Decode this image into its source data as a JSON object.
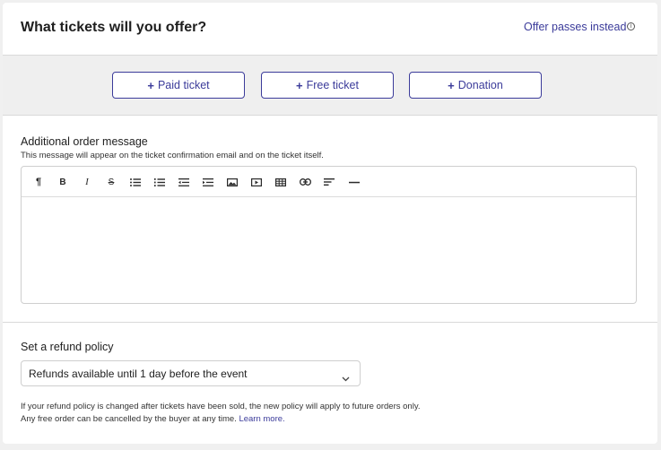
{
  "header": {
    "title": "What tickets will you offer?",
    "offer_passes_link": "Offer passes instead",
    "info_icon": "info-icon"
  },
  "ticket_buttons": [
    {
      "plus": "+",
      "label": "Paid ticket"
    },
    {
      "plus": "+",
      "label": "Free ticket"
    },
    {
      "plus": "+",
      "label": "Donation"
    }
  ],
  "order_message": {
    "label": "Additional order message",
    "helper": "This message will appear on the ticket confirmation email and on the ticket itself.",
    "toolbar": [
      {
        "icon": "paragraph-icon",
        "glyph": "¶"
      },
      {
        "icon": "bold-icon",
        "glyph": "B"
      },
      {
        "icon": "italic-icon",
        "glyph": "I"
      },
      {
        "icon": "strikethrough-icon",
        "glyph": "S"
      },
      {
        "icon": "bulleted-list-icon",
        "glyph": ""
      },
      {
        "icon": "numbered-list-icon",
        "glyph": ""
      },
      {
        "icon": "outdent-icon",
        "glyph": ""
      },
      {
        "icon": "indent-icon",
        "glyph": ""
      },
      {
        "icon": "image-icon",
        "glyph": ""
      },
      {
        "icon": "video-icon",
        "glyph": ""
      },
      {
        "icon": "table-icon",
        "glyph": ""
      },
      {
        "icon": "link-icon",
        "glyph": ""
      },
      {
        "icon": "align-left-icon",
        "glyph": ""
      },
      {
        "icon": "horizontal-rule-icon",
        "glyph": ""
      }
    ],
    "value": ""
  },
  "refund": {
    "label": "Set a refund policy",
    "selected": "Refunds available until 1 day before the event",
    "note_line1": "If your refund policy is changed after tickets have been sold, the new policy will apply to future orders only.",
    "note_line2": "Any free order can be cancelled by the buyer at any time.",
    "learn_more": "Learn more."
  },
  "colors": {
    "accent": "#3b3b9a",
    "band": "#efefef",
    "border": "#cfcfcf"
  }
}
